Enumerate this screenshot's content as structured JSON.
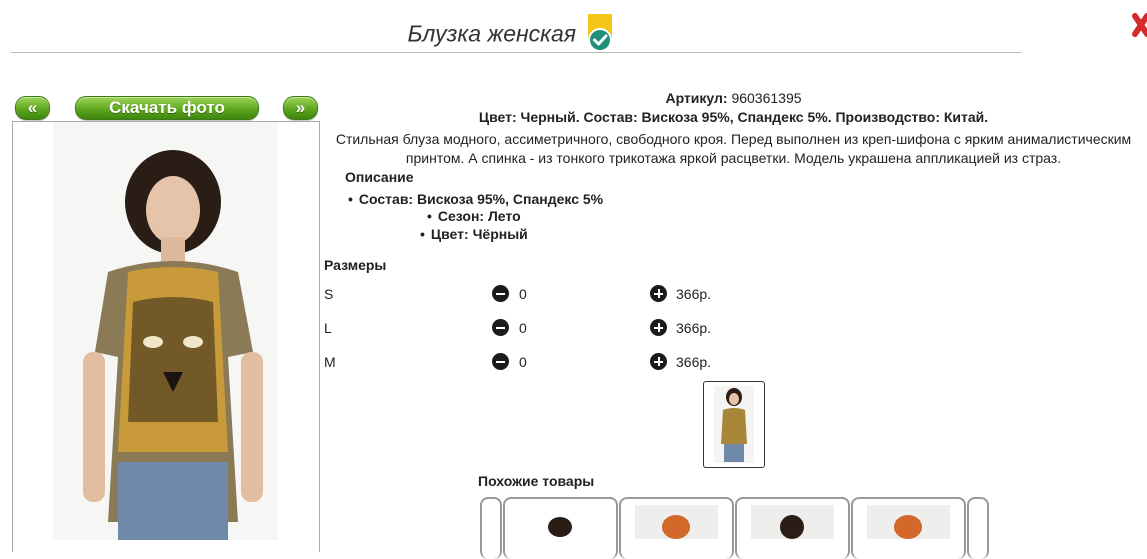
{
  "header": {
    "title": "Блузка женская"
  },
  "gallery": {
    "prev_label": "«",
    "download_label": "Скачать фото",
    "next_label": "»"
  },
  "product": {
    "article_label": "Артикул:",
    "article_value": "960361395",
    "meta": "Цвет: Черный. Состав: Вискоза 95%, Спандекс 5%. Производство: Китай.",
    "description_line1": "Стильная блуза модного, ассиметричного, свободного кроя. Перед выполнен из креп-шифона с ярким анималистическим",
    "description_line2": "принтом. А спинка - из тонкого трикотажа яркой расцветки. Модель украшена аппликацией из страз.",
    "description_heading": "Описание",
    "properties": [
      "Состав: Вискоза 95%, Спандекс 5%",
      "Сезон: Лето",
      "Цвет: Чёрный"
    ]
  },
  "sizes": {
    "heading": "Размеры",
    "rows": [
      {
        "size": "S",
        "qty": "0",
        "price": "366р."
      },
      {
        "size": "L",
        "qty": "0",
        "price": "366р."
      },
      {
        "size": "M",
        "qty": "0",
        "price": "366р."
      }
    ]
  },
  "similar": {
    "heading": "Похожие товары"
  },
  "colors": {
    "accent_green": "#5ea81d",
    "badge_yellow": "#f5c518",
    "badge_teal": "#1f8e7a",
    "close_red": "#d42a2a"
  },
  "icons": [
    "verified-check-icon",
    "close-icon",
    "minus-circle-icon",
    "plus-circle-icon"
  ]
}
